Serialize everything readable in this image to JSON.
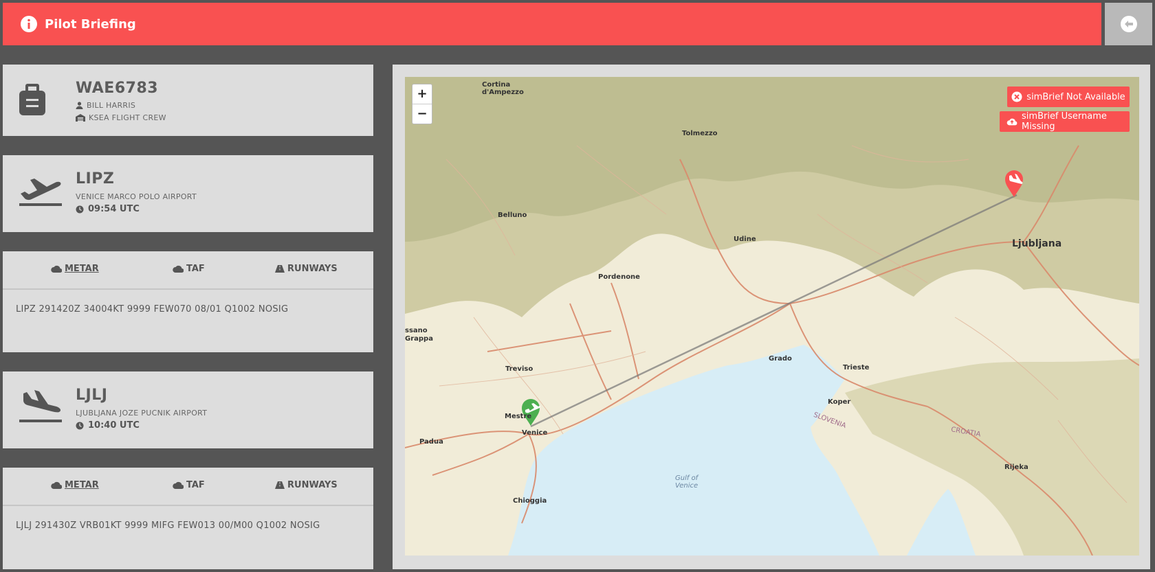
{
  "header": {
    "title": "Pilot Briefing",
    "info_icon": "info-circle-icon",
    "back_icon": "arrow-left-circle-icon",
    "accent": "#f95151"
  },
  "flight": {
    "callsign": "WAE6783",
    "pilot": "BILL HARRIS",
    "crew": "KSEA FLIGHT CREW",
    "icon": "suitcase-icon"
  },
  "departure": {
    "icao": "LIPZ",
    "name": "VENICE MARCO POLO AIRPORT",
    "time": "09:54 UTC",
    "icon": "plane-departure-icon",
    "tabs": [
      "METAR",
      "TAF",
      "RUNWAYS"
    ],
    "active_tab": "METAR",
    "metar": "LIPZ 291420Z 34004KT 9999 FEW070 08/01 Q1002 NOSIG"
  },
  "arrival": {
    "icao": "LJLJ",
    "name": "LJUBLJANA JOZE PUCNIK AIRPORT",
    "time": "10:40 UTC",
    "icon": "plane-arrival-icon",
    "tabs": [
      "METAR",
      "TAF",
      "RUNWAYS"
    ],
    "active_tab": "METAR",
    "metar": "LJLJ 291430Z VRB01KT 9999 MIFG FEW013 00/M00 Q1002 NOSIG"
  },
  "map": {
    "zoom_in": "+",
    "zoom_out": "−",
    "simbrief_unavailable": "simBrief Not Available",
    "simbrief_username_missing": "simBrief Username Missing",
    "places": {
      "cortina": "Cortina d'Ampezzo",
      "tolmezzo": "Tolmezzo",
      "belluno": "Belluno",
      "udine": "Udine",
      "pordenone": "Pordenone",
      "ljubljana": "Ljubljana",
      "bassano": "ssano\nGrappa",
      "treviso": "Treviso",
      "grado": "Grado",
      "trieste": "Trieste",
      "koper": "Koper",
      "mestre": "Mestre",
      "venice": "Venice",
      "padua": "Padua",
      "chioggia": "Chioggia",
      "rijeka": "Rijeka",
      "gulf": "Gulf of\nVenice",
      "slovenia": "SLOVENIA",
      "croatia": "CROATIA"
    },
    "dep_marker_color": "#4caf50",
    "arr_marker_color": "#f95151"
  }
}
